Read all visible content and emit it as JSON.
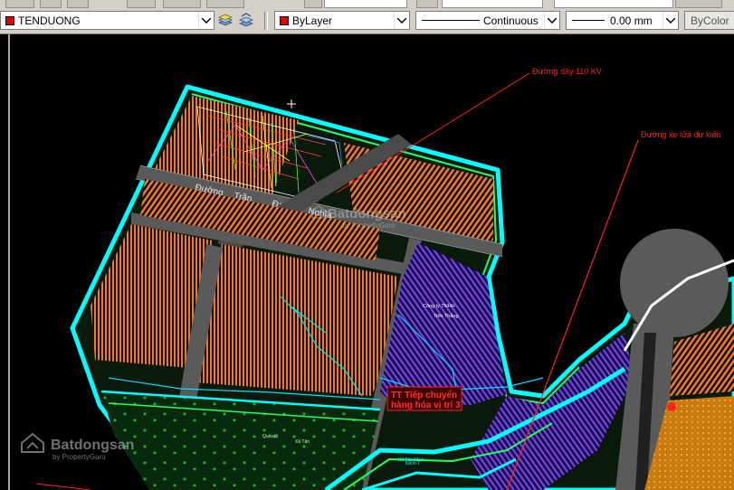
{
  "toolbar": {
    "layer_name": "TENDUONG",
    "color_value": "ByLayer",
    "linetype_value": "Continuous",
    "lineweight_value": "0.00 mm",
    "plotstyle_value": "ByColor"
  },
  "drawing": {
    "label_power_line": "Đường dây  110 KV",
    "label_railway": "Đường xe lửa dự kiến",
    "road_words": [
      "Đường",
      "Trần",
      "Đại",
      "Nghĩa"
    ],
    "company_line1": "Công ty TNHH",
    "company_line2": "Tiến Thắng",
    "box_line1": "TT Tiếp chuyển",
    "box_line2": "hàng hóa vị trí 3",
    "canal_small_1": "Xã Tân Nhựt",
    "canal_small_2": "Kênh 7",
    "road_small_1": "Quốc lộ",
    "road_small_2": "Xã Tân",
    "colors": {
      "background": "#000000",
      "boundary": "#00ffff",
      "land_orange": "#ff8c3a",
      "land_purple": "#6a38d8",
      "land_green": "#0d4a12",
      "road": "#5a5a5a",
      "annotation_red": "#ff2020"
    }
  },
  "watermarks": {
    "center_text": "Batdongsan",
    "center_sub": "by PropertyGuru",
    "corner_text": "Batdongsan",
    "corner_sub": "by PropertyGuru"
  },
  "icons": {
    "layer_states": "layer-stack-icon",
    "layer_previous": "layer-previous-icon",
    "dropdown": "chevron-down-icon"
  }
}
